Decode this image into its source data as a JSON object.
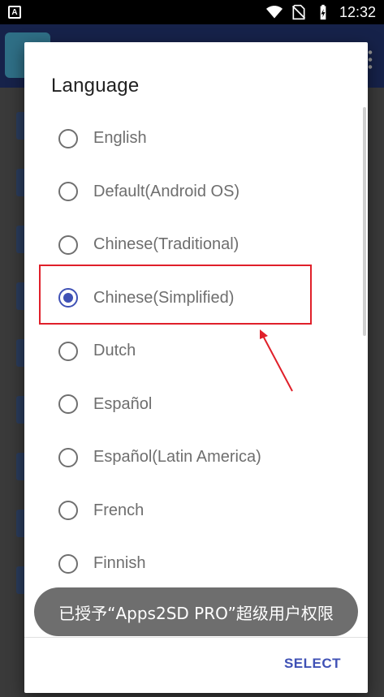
{
  "status_bar": {
    "app_icon_letter": "A",
    "time": "12:32",
    "icons": [
      "wifi-icon",
      "no-sim-icon",
      "battery-charging-icon"
    ]
  },
  "dialog": {
    "title": "Language",
    "options": [
      {
        "label": "English",
        "checked": false
      },
      {
        "label": "Default(Android OS)",
        "checked": false
      },
      {
        "label": "Chinese(Traditional)",
        "checked": false
      },
      {
        "label": "Chinese(Simplified)",
        "checked": true
      },
      {
        "label": "Dutch",
        "checked": false
      },
      {
        "label": "Español",
        "checked": false
      },
      {
        "label": "Español(Latin America)",
        "checked": false
      },
      {
        "label": "French",
        "checked": false
      },
      {
        "label": "Finnish",
        "checked": false
      }
    ],
    "select_label": "SELECT"
  },
  "toast": {
    "text": "已授予“Apps2SD PRO”超级用户权限"
  },
  "colors": {
    "accent": "#3f51b5",
    "annotation": "#e0202a"
  }
}
